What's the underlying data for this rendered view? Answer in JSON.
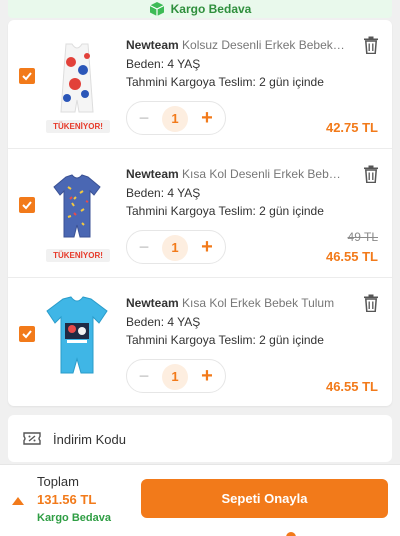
{
  "banner": {
    "label": "Kargo Bedava"
  },
  "items": [
    {
      "brand": "Newteam",
      "name": "Kolsuz Desenli Erkek Bebek T...",
      "size": "Beden: 4 YAŞ",
      "delivery": "Tahmini Kargoya Teslim: 2 gün içinde",
      "quantity": "1",
      "price": "42.75 TL",
      "old_price": "",
      "badge": "TÜKENİYOR!",
      "checked": true
    },
    {
      "brand": "Newteam",
      "name": "Kısa Kol Desenli Erkek Bebek ...",
      "size": "Beden: 4 YAŞ",
      "delivery": "Tahmini Kargoya Teslim: 2 gün içinde",
      "quantity": "1",
      "price": "46.55 TL",
      "old_price": "49 TL",
      "badge": "TÜKENİYOR!",
      "checked": true
    },
    {
      "brand": "Newteam",
      "name": "Kısa Kol Erkek Bebek Tulum",
      "size": "Beden: 4 YAŞ",
      "delivery": "Tahmini Kargoya Teslim: 2 gün içinde",
      "quantity": "1",
      "price": "46.55 TL",
      "old_price": "",
      "badge": "",
      "checked": true
    }
  ],
  "quantity_controls": {
    "minus": "−",
    "plus": "+"
  },
  "coupon": {
    "label": "İndirim Kodu",
    "icon": "ticket-icon"
  },
  "footer": {
    "total_label": "Toplam",
    "total_value": "131.56 TL",
    "shipping_label": "Kargo Bedava",
    "confirm_label": "Sepeti Onayla"
  },
  "colors": {
    "accent": "#f27a1a",
    "success": "#2f9e44",
    "banner_bg": "#e9f9ec",
    "badge_text": "#e63a2a"
  }
}
